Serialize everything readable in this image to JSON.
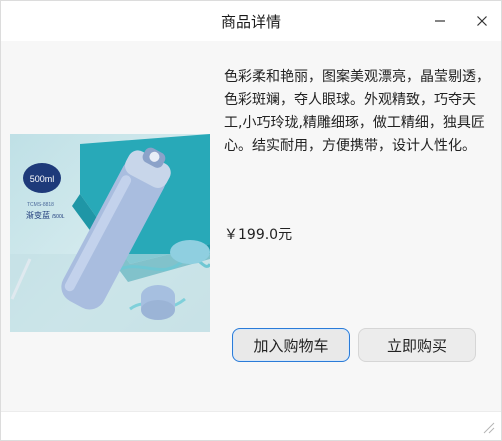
{
  "window": {
    "title": "商品详情",
    "minimize_icon": "minimize-icon",
    "close_icon": "close-icon"
  },
  "product": {
    "description": "色彩柔和艳丽，图案美观漂亮，晶莹剔透，色彩斑斓，夺人眼球。外观精致，巧夺天工,小巧玲珑,精雕细琢，做工精细，独具匠心。结实耐用，方便携带，设计人性化。",
    "price": "￥199.0元",
    "image": {
      "capacity_badge": "500ml",
      "model_text": "TCMS-8818",
      "color_name": "渐变蓝",
      "color_suffix": "/500L"
    }
  },
  "actions": {
    "add_to_cart": "加入购物车",
    "buy_now": "立即购买"
  },
  "colors": {
    "accent": "#2a7bd8",
    "badge": "#1e3a7a"
  }
}
